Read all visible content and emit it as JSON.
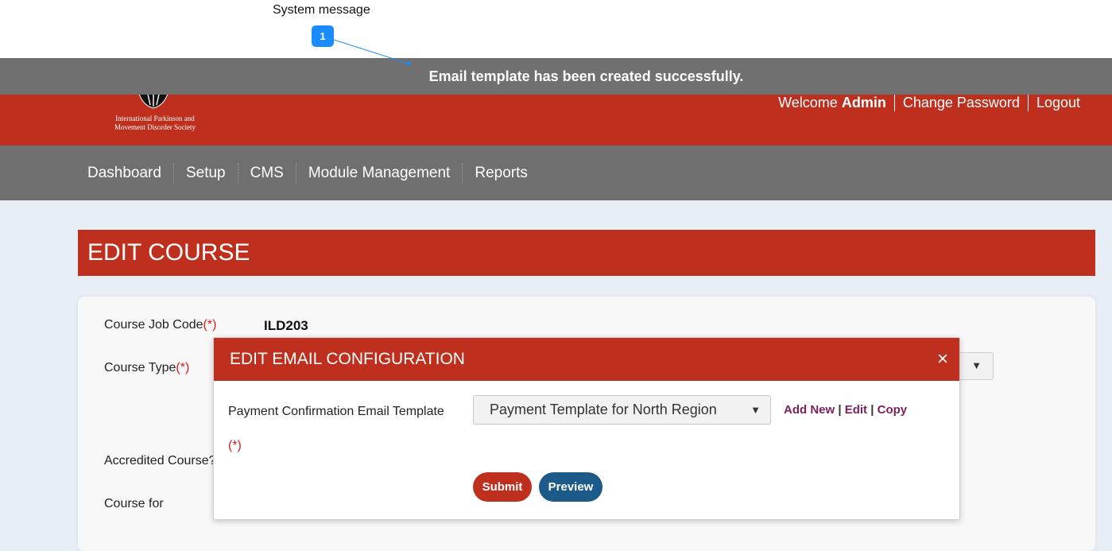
{
  "annotation": {
    "label": "System message",
    "badge": "1"
  },
  "system_message": "Email template has been created successfully.",
  "header": {
    "logo_text_line1": "International Parkinson and",
    "logo_text_line2": "Movement Disorder Society",
    "welcome_prefix": "Welcome",
    "welcome_user": "Admin",
    "change_password": "Change Password",
    "logout": "Logout"
  },
  "nav": {
    "items": [
      "Dashboard",
      "Setup",
      "CMS",
      "Module Management",
      "Reports"
    ]
  },
  "page_title": "EDIT COURSE",
  "form": {
    "course_job_code_label": "Course Job Code",
    "course_job_code_value": "ILD203",
    "course_type_label": "Course Type",
    "accredited_course_label": "Accredited Course?",
    "course_for_label": "Course for",
    "required_mark": "(*)"
  },
  "modal": {
    "title": "EDIT EMAIL CONFIGURATION",
    "close_symbol": "×",
    "field_label": "Payment Confirmation Email Template",
    "required_mark": "(*)",
    "selected_template": "Payment Template for North Region",
    "links": {
      "add_new": "Add New",
      "edit": "Edit",
      "copy": "Copy"
    },
    "submit": "Submit",
    "preview": "Preview"
  },
  "colors": {
    "brand_red": "#be2f1e",
    "nav_gray": "#6f6f6f",
    "preview_blue": "#1c5a8a",
    "link_purple": "#7a1f5c",
    "annotation_blue": "#1a8cff"
  }
}
